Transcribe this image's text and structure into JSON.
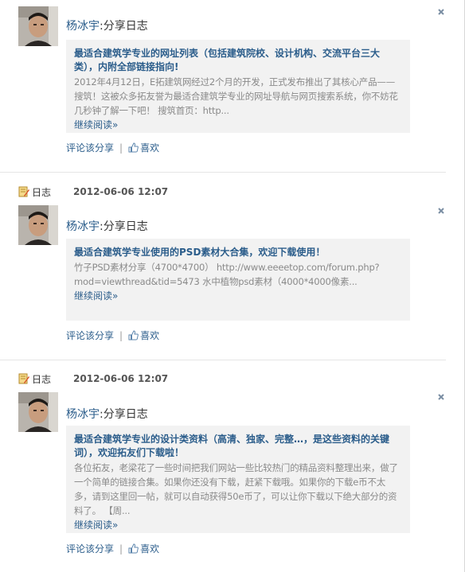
{
  "posts": [
    {
      "author": "杨冰宇",
      "action": ":分享日志",
      "title": "最适合建筑学专业的网址列表（包括建筑院校、设计机构、交流平台三大类），内附全部链接指向!",
      "body": "2012年4月12日，E拓建筑网经过2个月的开发，正式发布推出了其核心产品——搜筑！这被众多拓友誉为最适合建筑学专业的网址导航与网页搜索系统，你不妨花几秒钟了解一下吧！ 搜筑首页：http...",
      "more": "继续阅读»",
      "comment": "评论该分享",
      "separator": "|",
      "like": "喜欢"
    },
    {
      "type_label": "日志",
      "time": "2012-06-06 12:07",
      "author": "杨冰宇",
      "action": ":分享日志",
      "title": "最适合建筑学专业使用的PSD素材大合集，欢迎下载使用！",
      "body": "竹子PSD素材分享（4700*4700） http://www.eeeetop.com/forum.php?mod=viewthread&tid=5473 水中植物psd素材（4000*4000像素...",
      "more": "继续阅读»",
      "comment": "评论该分享",
      "separator": "|",
      "like": "喜欢"
    },
    {
      "type_label": "日志",
      "time": "2012-06-06 12:07",
      "author": "杨冰宇",
      "action": ":分享日志",
      "title": "最适合建筑学专业的设计类资料（高清、独家、完整…，是这些资料的关键词），欢迎拓友们下载啦！",
      "body": "各位拓友，老梁花了一些时间把我们网站一些比较热门的精品资料整理出来，做了一个简单的链接合集。如果你还没有下载，赶紧下载哦。如果你的下载e币不太多，请到这里回一帖，就可以自动获得50e币了，可以让你下载以下绝大部分的资料了。 【周...",
      "more": "继续阅读»",
      "comment": "评论该分享",
      "separator": "|",
      "like": "喜欢"
    }
  ],
  "colors": {
    "link": "#2b5d8b",
    "quote_bg": "#f2f2f2",
    "muted_text": "#8a8a8a"
  },
  "icons": {
    "close": "close-icon",
    "like": "thumbs-up-icon",
    "blog": "blog-pencil-icon"
  }
}
